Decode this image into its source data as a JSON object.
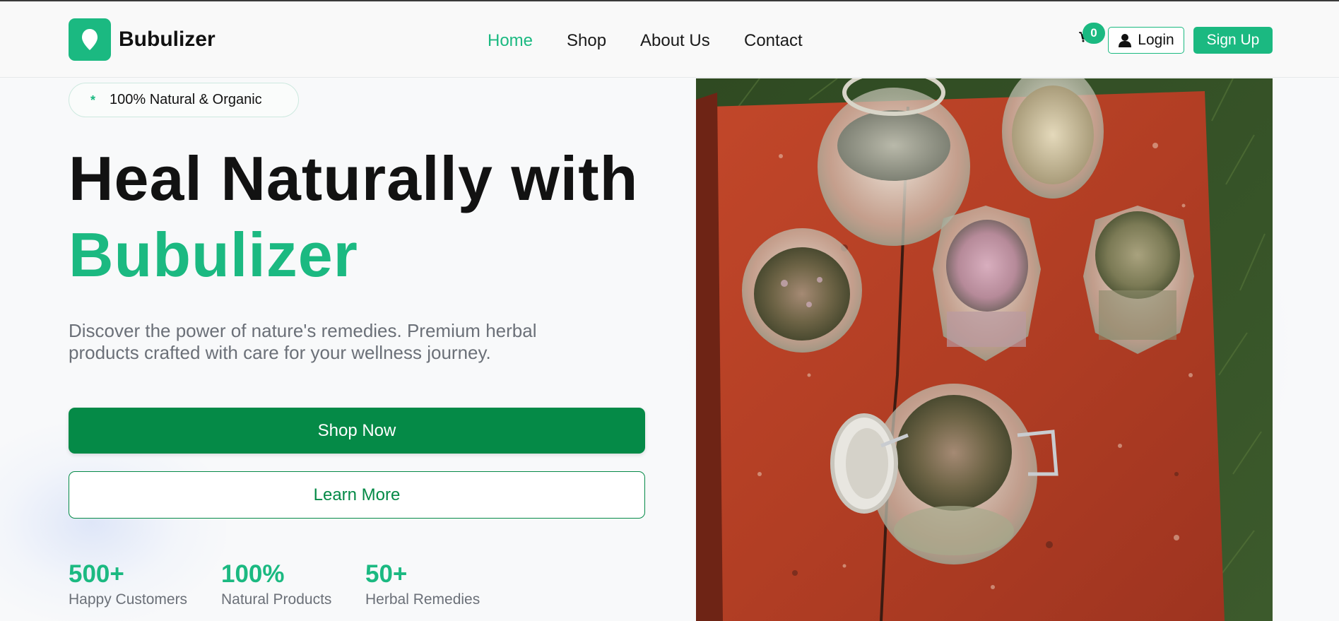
{
  "brand": {
    "name": "Bubulizer",
    "accent": "#1bb981",
    "dark_green": "#058a47"
  },
  "nav": {
    "items": [
      {
        "label": "Home",
        "active": true
      },
      {
        "label": "Shop",
        "active": false
      },
      {
        "label": "About Us",
        "active": false
      },
      {
        "label": "Contact",
        "active": false
      }
    ]
  },
  "header": {
    "cart_count": "0",
    "login_label": "Login",
    "signup_label": "Sign Up",
    "icons": {
      "logo": "leaf-drop-icon",
      "cart": "cart-icon",
      "user": "user-icon"
    }
  },
  "hero": {
    "badge_icon": "*",
    "badge": "100% Natural & Organic",
    "title_line1": "Heal Naturally with",
    "title_line2": "Bubulizer",
    "description": "Discover the power of nature's remedies. Premium herbal products crafted with care for your wellness journey.",
    "primary_button": "Shop Now",
    "secondary_button": "Learn More",
    "image_subject": "jars-of-dried-herbs-on-red-wooden-stool"
  },
  "stats": [
    {
      "value": "500+",
      "label": "Happy Customers"
    },
    {
      "value": "100%",
      "label": "Natural Products"
    },
    {
      "value": "50+",
      "label": "Herbal Remedies"
    }
  ]
}
